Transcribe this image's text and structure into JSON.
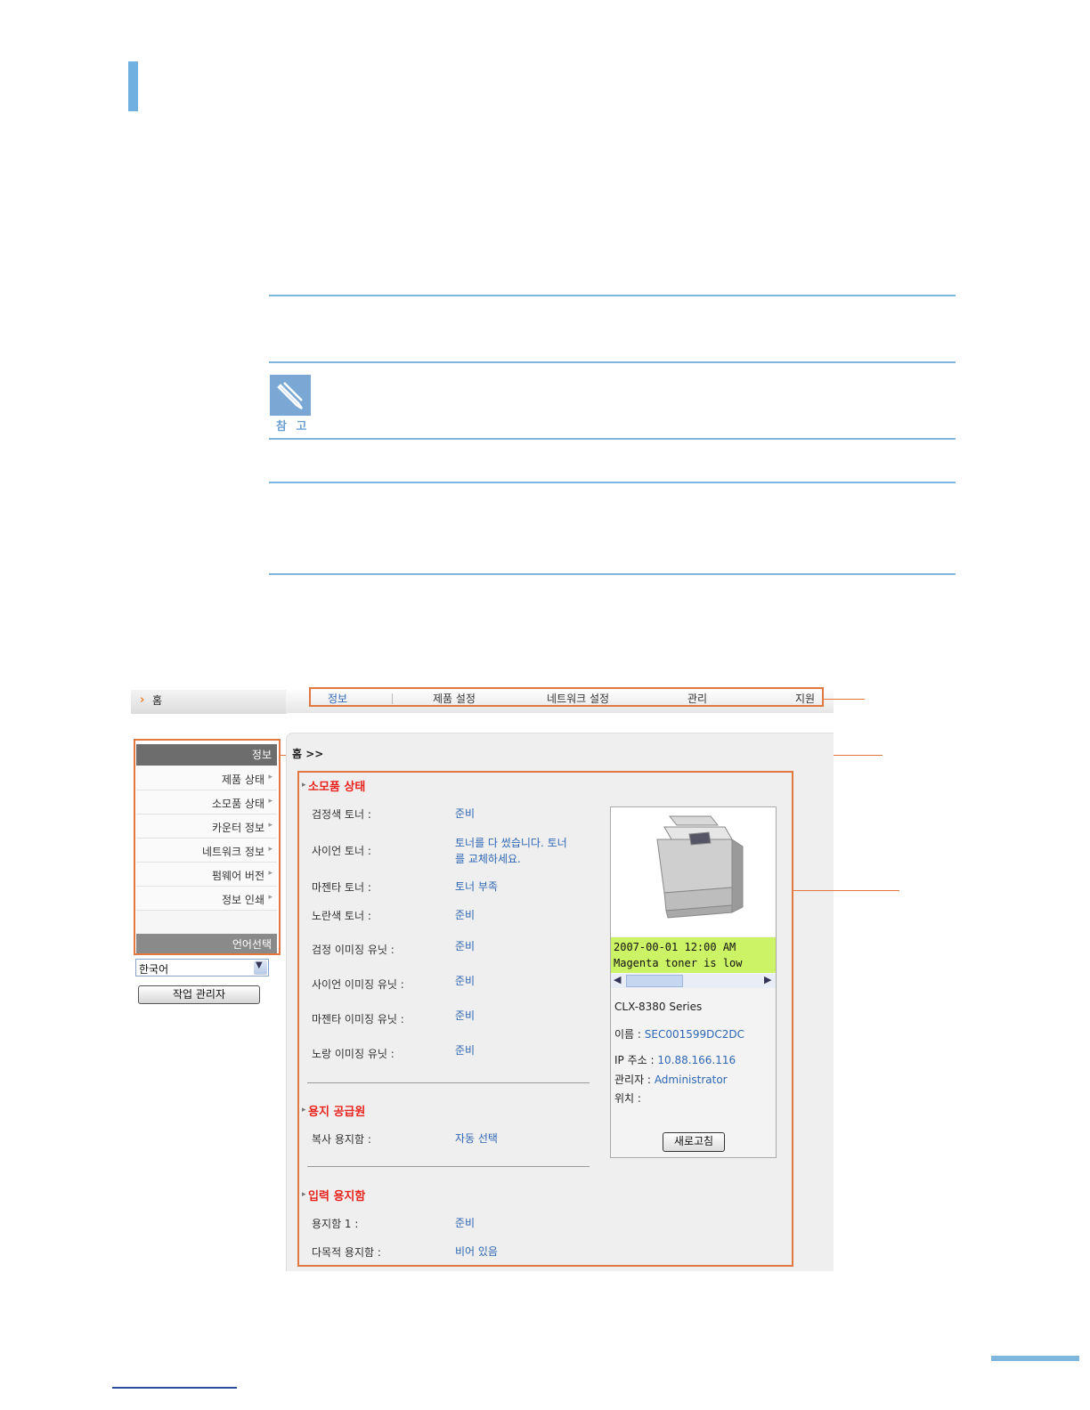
{
  "page": {
    "note_label": "참 고"
  },
  "screenshot": {
    "home": "홈",
    "tabs": [
      "정보",
      "제품 설정",
      "네트워크 설정",
      "관리",
      "지원"
    ],
    "breadcrumb": "홈 >>",
    "leftnav": {
      "title": "정보",
      "items": [
        "제품 상태",
        "소모품 상태",
        "카운터 정보",
        "네트워크 정보",
        "펌웨어 버전",
        "정보 인쇄"
      ],
      "lang_title": "언어선택"
    },
    "lang_select": {
      "value": "한국어"
    },
    "job_button": "작업 관리자",
    "supplies": {
      "title": "소모품 상태",
      "rows": [
        {
          "label": "검정색 토너 :",
          "value": "준비"
        },
        {
          "label": "사이언 토너 :",
          "value": "토너를 다 썼습니다. 토너",
          "value2": "를 교체하세요."
        },
        {
          "label": "마젠타 토너 :",
          "value": "토너 부족"
        },
        {
          "label": "노란색 토너 :",
          "value": "준비"
        },
        {
          "label": "검정 이미징 유닛 :",
          "value": "준비"
        },
        {
          "label": "사이언 이미징 유닛 :",
          "value": "준비"
        },
        {
          "label": "마젠타 이미징 유닛 :",
          "value": "준비"
        },
        {
          "label": "노랑 이미징 유닛 :",
          "value": "준비"
        }
      ]
    },
    "paper_source": {
      "title": "용지 공급원",
      "rows": [
        {
          "label": "복사 용지함 :",
          "value": "자동 선택"
        }
      ]
    },
    "input_tray": {
      "title": "입력 용지함",
      "rows": [
        {
          "label": "용지함 1 :",
          "value": "준비"
        },
        {
          "label": "다목적 용지함 :",
          "value": "비어 있음"
        }
      ]
    },
    "info_panel": {
      "lcd_line1": "2007-00-01 12:00  AM",
      "lcd_line2": "Magenta toner is low",
      "model": "CLX-8380 Series",
      "name_label": "이름 :",
      "name_value": "SEC001599DC2DC",
      "ip_label": "IP 주소 :",
      "ip_value": "10.88.166.116",
      "admin_label": "관리자 :",
      "admin_value": "Administrator",
      "location_label": "위치 :",
      "refresh_button": "새로고침"
    },
    "colors": {
      "accent_orange": "#e2783f",
      "section_red": "#e8231d",
      "link_blue": "#2f67b5",
      "lcd_green": "#ccf266"
    }
  }
}
